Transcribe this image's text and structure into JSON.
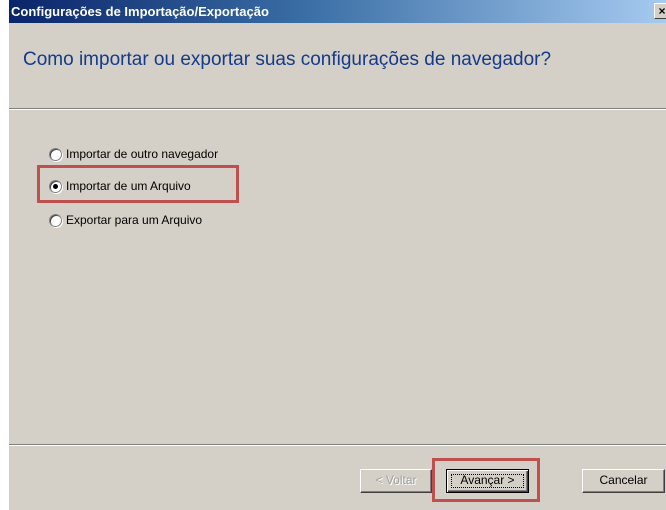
{
  "window": {
    "title": "Configurações de Importação/Exportação",
    "close_symbol": "×"
  },
  "header": {
    "title": "Como importar ou exportar suas configurações de navegador?"
  },
  "options": [
    {
      "label": "Importar de outro navegador",
      "selected": false,
      "highlighted": false
    },
    {
      "label": "Importar de um Arquivo",
      "selected": true,
      "highlighted": true
    },
    {
      "label": "Exportar para um Arquivo",
      "selected": false,
      "highlighted": false
    }
  ],
  "buttons": {
    "back_label": "< Voltar",
    "back_enabled": false,
    "next_label": "Avançar >",
    "next_highlighted": true,
    "cancel_label": "Cancelar"
  },
  "colors": {
    "highlight": "#c0504d",
    "title_text": "#153a8a",
    "dialog_face": "#d4d0c8",
    "titlebar_start": "#0a246a"
  }
}
